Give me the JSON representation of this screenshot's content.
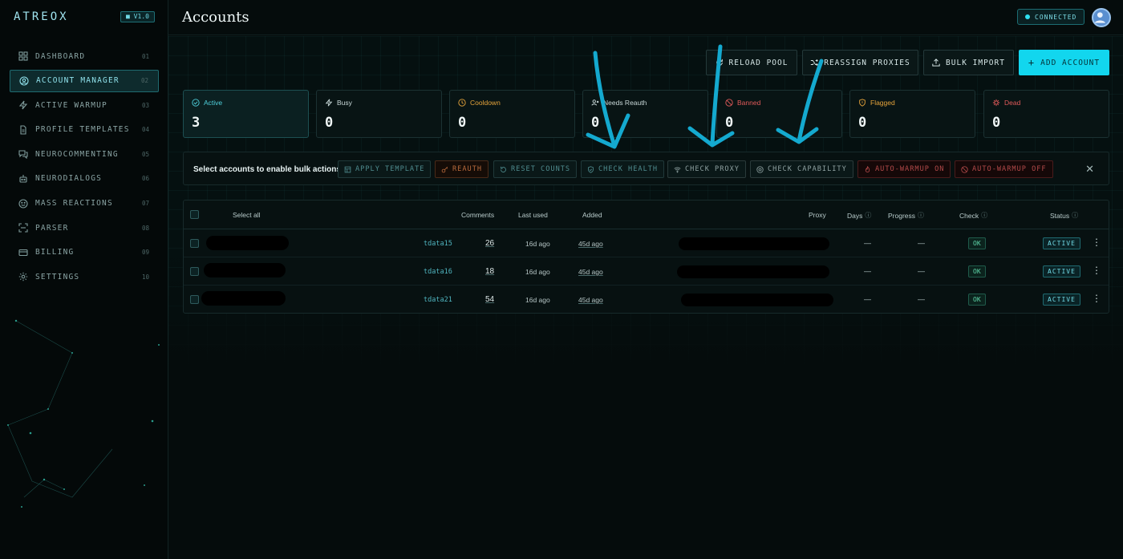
{
  "app": {
    "brand": "ATREOX",
    "version": "■ V1.0"
  },
  "sidebar": {
    "items": [
      {
        "label": "DASHBOARD",
        "num": "01",
        "icon": "grid-icon"
      },
      {
        "label": "ACCOUNT MANAGER",
        "num": "02",
        "icon": "user-circle-icon"
      },
      {
        "label": "ACTIVE WARMUP",
        "num": "03",
        "icon": "bolt-icon"
      },
      {
        "label": "PROFILE TEMPLATES",
        "num": "04",
        "icon": "document-icon"
      },
      {
        "label": "NEUROCOMMENTING",
        "num": "05",
        "icon": "chat-icon"
      },
      {
        "label": "NEURODIALOGS",
        "num": "06",
        "icon": "bot-icon"
      },
      {
        "label": "MASS REACTIONS",
        "num": "07",
        "icon": "smile-icon"
      },
      {
        "label": "PARSER",
        "num": "08",
        "icon": "scan-icon"
      },
      {
        "label": "BILLING",
        "num": "09",
        "icon": "card-icon"
      },
      {
        "label": "SETTINGS",
        "num": "10",
        "icon": "gear-icon"
      }
    ]
  },
  "header": {
    "title": "Accounts",
    "status": "CONNECTED"
  },
  "toolbar": {
    "reload": "RELOAD POOL",
    "reassign": "REASSIGN PROXIES",
    "bulk_import": "BULK IMPORT",
    "add_account": "ADD ACCOUNT"
  },
  "stats": [
    {
      "label": "Active",
      "value": "3",
      "color": "#4fd0dc"
    },
    {
      "label": "Busy",
      "value": "0",
      "color": "#c9d9d9"
    },
    {
      "label": "Cooldown",
      "value": "0",
      "color": "#e6a43b"
    },
    {
      "label": "Needs Reauth",
      "value": "0",
      "color": "#c9d9d9"
    },
    {
      "label": "Banned",
      "value": "0",
      "color": "#e05a5a"
    },
    {
      "label": "Flagged",
      "value": "0",
      "color": "#e6a43b"
    },
    {
      "label": "Dead",
      "value": "0",
      "color": "#e05a5a"
    }
  ],
  "bulk": {
    "label": "Select accounts to enable bulk actions",
    "actions": {
      "apply_template": "APPLY TEMPLATE",
      "reauth": "REAUTH",
      "reset_counts": "RESET COUNTS",
      "check_health": "CHECK HEALTH",
      "check_proxy": "CHECK PROXY",
      "check_capability": "CHECK CAPABILITY",
      "warmup_on": "AUTO-WARMUP ON",
      "warmup_off": "AUTO-WARMUP OFF"
    }
  },
  "table": {
    "headers": {
      "select_all": "Select all",
      "comments": "Comments",
      "last_used": "Last used",
      "added": "Added",
      "proxy": "Proxy",
      "days": "Days",
      "progress": "Progress",
      "check": "Check",
      "status": "Status"
    },
    "rows": [
      {
        "session": "tdata15",
        "comments": "26",
        "last_used": "16d ago",
        "added": "45d ago",
        "days": "—",
        "progress": "—",
        "check": "OK",
        "status": "ACTIVE"
      },
      {
        "session": "tdata16",
        "comments": "18",
        "last_used": "16d ago",
        "added": "45d ago",
        "days": "—",
        "progress": "—",
        "check": "OK",
        "status": "ACTIVE"
      },
      {
        "session": "tdata21",
        "comments": "54",
        "last_used": "16d ago",
        "added": "45d ago",
        "days": "—",
        "progress": "—",
        "check": "OK",
        "status": "ACTIVE"
      }
    ]
  },
  "colors": {
    "accent": "#12d6ee",
    "annotation": "#14a9cf"
  }
}
